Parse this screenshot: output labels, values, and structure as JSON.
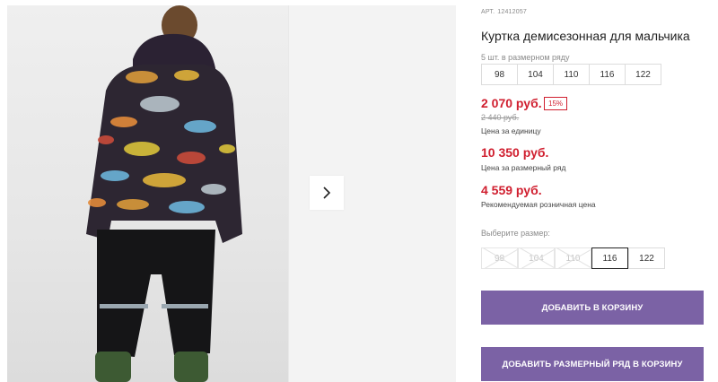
{
  "gallery": {
    "next_icon": "chevron-right-icon"
  },
  "product": {
    "art_label": "АРТ.",
    "art_value": "12412057",
    "title": "Куртка демисезонная для мальчика",
    "row_caption": "5 шт. в размерном ряду",
    "row_sizes": [
      "98",
      "104",
      "110",
      "116",
      "122"
    ]
  },
  "pricing": {
    "unit_price": "2 070 руб.",
    "discount": "15%",
    "old_price": "2 440 руб.",
    "unit_caption": "Цена за единицу",
    "row_price": "10 350 руб.",
    "row_caption": "Цена за размерный ряд",
    "retail_price": "4 559 руб.",
    "retail_caption": "Рекомендуемая розничная цена",
    "price_color": "#d01f2f"
  },
  "size_select": {
    "caption": "Выберите размер:",
    "options": [
      "98",
      "104",
      "110",
      "116",
      "122"
    ],
    "disabled": [
      "98",
      "104",
      "110"
    ],
    "selected": "116"
  },
  "actions": {
    "add_to_cart": "ДОБАВИТЬ В КОРЗИНУ",
    "add_row_to_cart": "ДОБАВИТЬ РАЗМЕРНЫЙ РЯД В КОРЗИНУ",
    "accent_color": "#7b62a5"
  }
}
